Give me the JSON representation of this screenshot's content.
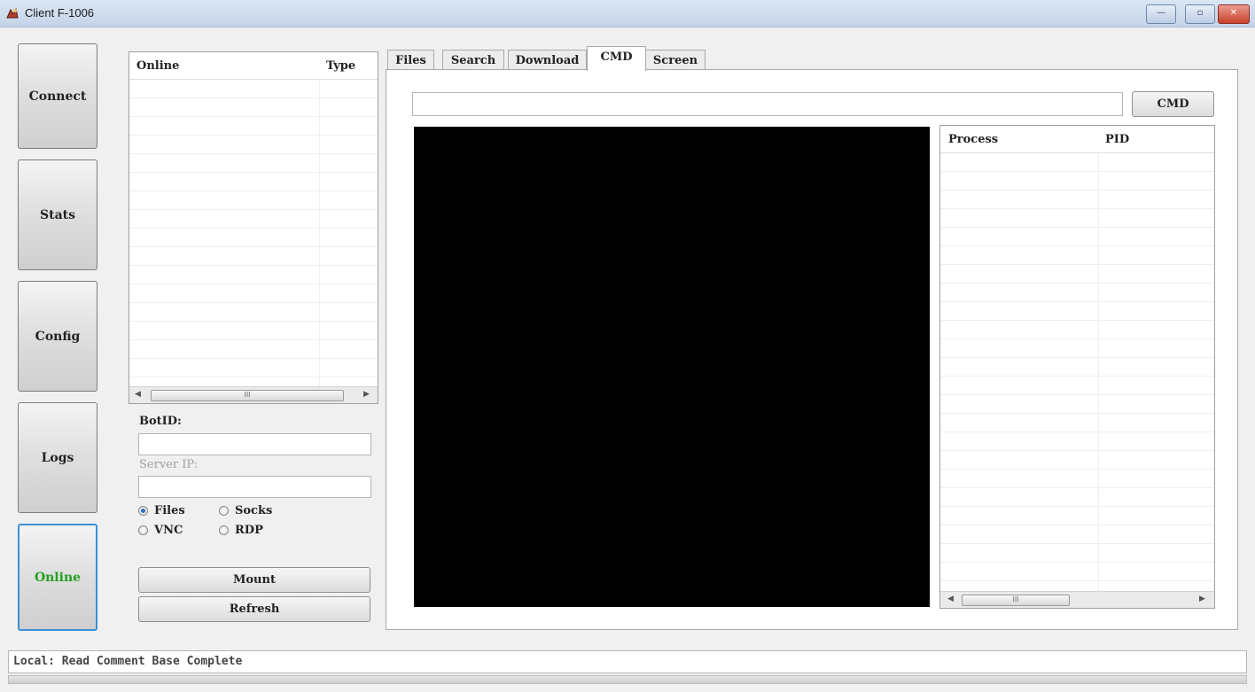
{
  "window": {
    "title": "Client F-1006",
    "minimize_label": "—",
    "maximize_label": "▫",
    "close_label": "✕"
  },
  "nav": {
    "connect": "Connect",
    "stats": "Stats",
    "config": "Config",
    "logs": "Logs",
    "online": "Online",
    "active": "Online"
  },
  "online_list": {
    "columns": [
      "Online",
      "Type"
    ],
    "scroll_thumb": "III"
  },
  "bot_form": {
    "botid_label": "BotID:",
    "botid_value": "",
    "server_ip_label": "Server IP:",
    "server_ip_value": "",
    "radios": [
      {
        "label": "Files",
        "checked": true
      },
      {
        "label": "Socks",
        "checked": false
      },
      {
        "label": "VNC",
        "checked": false
      },
      {
        "label": "RDP",
        "checked": false
      }
    ],
    "mount_label": "Mount",
    "refresh_label": "Refresh"
  },
  "tabs": {
    "items": [
      "Files",
      "Search",
      "Download",
      "CMD",
      "Screen"
    ],
    "active": "CMD"
  },
  "cmd": {
    "input_value": "",
    "button_label": "CMD"
  },
  "process_list": {
    "columns": [
      "Process",
      "PID"
    ],
    "scroll_thumb": "III"
  },
  "status": {
    "text": "Local: Read Comment Base Complete"
  },
  "colors": {
    "online_active_text": "#22a022",
    "active_border": "#3c8fd6",
    "console_bg": "#000000"
  }
}
